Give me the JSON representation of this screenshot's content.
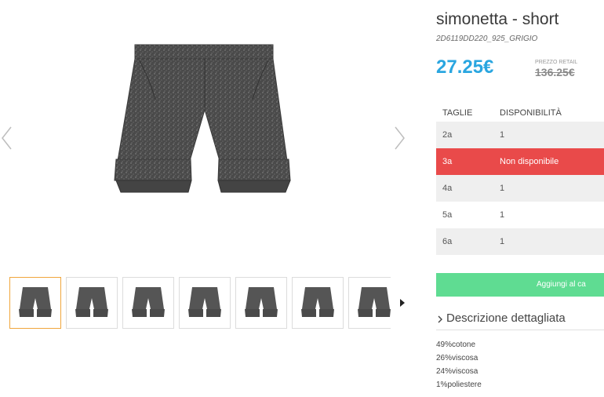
{
  "product": {
    "title": "simonetta - short",
    "sku": "2D6119DD220_925_GRIGIO",
    "price": "27.25€",
    "retail_label": "PREZZO RETAIL",
    "retail_price": "136.25€"
  },
  "gallery": {
    "thumbnail_count": 7,
    "active_thumbnail": 1
  },
  "size_table": {
    "headers": [
      "TAGLIE",
      "DISPONIBILITÀ"
    ],
    "rows": [
      {
        "size": "2a",
        "availability": "1"
      },
      {
        "size": "3a",
        "availability": "Non disponibile"
      },
      {
        "size": "4a",
        "availability": "1"
      },
      {
        "size": "5a",
        "availability": "1"
      },
      {
        "size": "6a",
        "availability": "1"
      }
    ]
  },
  "cart": {
    "label": "Aggiungi al ca"
  },
  "description": {
    "header": "Descrizione dettagliata",
    "composition": [
      "49%cotone",
      "26%viscosa",
      "24%viscosa",
      "1%poliestere"
    ]
  },
  "colors": {
    "price": "#2aa6e0",
    "unavailable": "#e94a4a",
    "cart": "#5fdc92",
    "active_thumb_border": "#f0a63c"
  }
}
